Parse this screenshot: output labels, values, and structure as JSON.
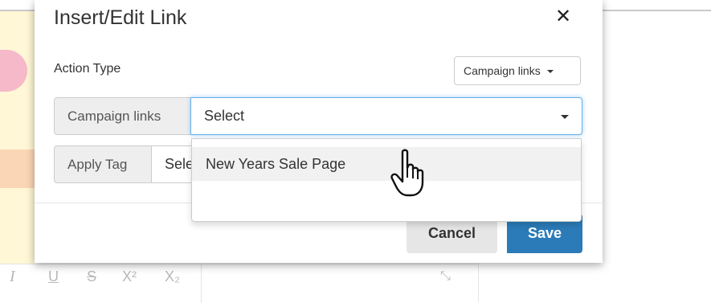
{
  "modal": {
    "title": "Insert/Edit Link",
    "close_glyph": "✕",
    "action_type_label": "Action Type",
    "action_type_button": "Campaign links",
    "campaign_links_addon": "Campaign links",
    "campaign_select_value": "Select",
    "apply_tag_addon": "Apply Tag",
    "apply_tag_value": "Sele",
    "cancel_label": "Cancel",
    "save_label": "Save"
  },
  "dropdown": {
    "options": [
      "New Years Sale Page"
    ]
  },
  "toolbar": {
    "italic": "I",
    "underline": "U",
    "strike": "S",
    "superscript": "X²",
    "subscript": "X₂"
  },
  "colors": {
    "primary": "#2b7bb9",
    "focus": "#66afe9",
    "addon_bg": "#eeeeee"
  }
}
